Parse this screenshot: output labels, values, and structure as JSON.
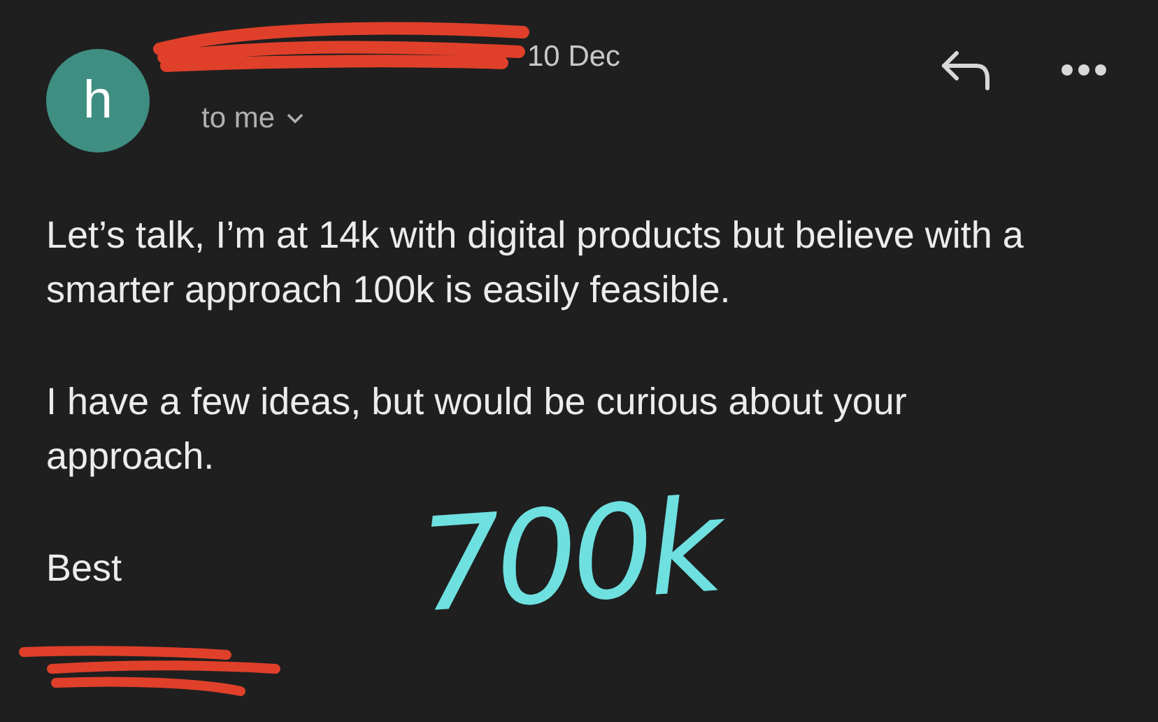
{
  "email": {
    "avatar_letter": "h",
    "sender": {
      "redacted": true
    },
    "date": "10 Dec",
    "recipient": "to me",
    "body": [
      "Let’s talk, I’m at 14k with digital products but believe with a smarter approach 100k is easily feasible.",
      "I have a few ideas, but would be curious about your approach.",
      "Best"
    ],
    "signature": {
      "redacted": true
    }
  },
  "annotation": {
    "text": "700k"
  }
}
